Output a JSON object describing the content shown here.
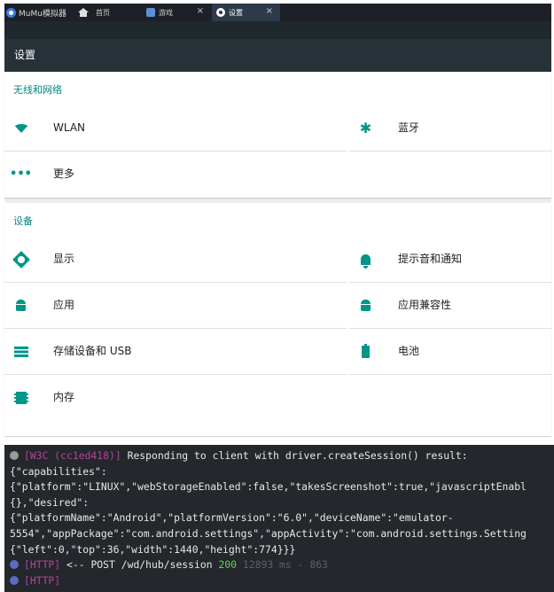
{
  "emulator": {
    "app_name": "MuMu模拟器",
    "tabs": [
      {
        "label": "首页"
      },
      {
        "label": "游戏"
      },
      {
        "label": "设置"
      }
    ],
    "close_symbol": "×"
  },
  "actionbar": {
    "title": "设置"
  },
  "sections": {
    "wireless": {
      "header": "无线和网络",
      "items": {
        "wlan": {
          "label": "WLAN",
          "icon": "wifi-icon"
        },
        "bluetooth": {
          "label": "蓝牙",
          "icon": "bluetooth-icon",
          "glyph": "✱"
        },
        "more": {
          "label": "更多",
          "icon": "more-icon",
          "glyph": "•••"
        }
      }
    },
    "device": {
      "header": "设备",
      "items": {
        "display": {
          "label": "显示",
          "icon": "brightness-icon"
        },
        "sound": {
          "label": "提示音和通知",
          "icon": "bell-icon"
        },
        "apps": {
          "label": "应用",
          "icon": "android-icon"
        },
        "compat": {
          "label": "应用兼容性",
          "icon": "android-icon"
        },
        "storage": {
          "label": "存储设备和 USB",
          "icon": "storage-icon"
        },
        "battery": {
          "label": "电池",
          "icon": "battery-icon"
        },
        "memory": {
          "label": "内存",
          "icon": "memory-icon"
        }
      }
    }
  },
  "console": {
    "line1_tag": "[W3C (cc1ed418)]",
    "line1_text": " Responding to client with driver.createSession() result:",
    "line2": "{\"capabilities\":",
    "line3": "{\"platform\":\"LINUX\",\"webStorageEnabled\":false,\"takesScreenshot\":true,\"javascriptEnabl",
    "line4": "{},\"desired\":",
    "line5": "{\"platformName\":\"Android\",\"platformVersion\":\"6.0\",\"deviceName\":\"emulator-",
    "line6": "5554\",\"appPackage\":\"com.android.settings\",\"appActivity\":\"com.android.settings.Setting",
    "line7": "{\"left\":0,\"top\":36,\"width\":1440,\"height\":774}}}",
    "http_tag": "[HTTP]",
    "http_text": " <-- POST /wd/hub/session ",
    "http_status": "200",
    "http_timing": " 12893 ms - 863"
  },
  "colors": {
    "accent": "#009688",
    "category": "#00897b",
    "actionbar": "#263238",
    "console_bg": "#24272b",
    "console_tag": "#b5449b",
    "console_ok": "#5fd35f"
  }
}
